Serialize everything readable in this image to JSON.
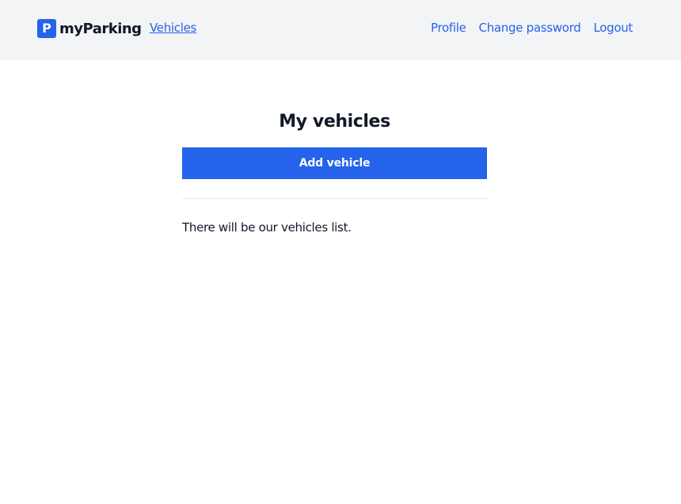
{
  "header": {
    "brand": {
      "icon_letter": "P",
      "name": "myParking",
      "icon_color": "#2563eb"
    },
    "nav_left": [
      {
        "label": "Vehicles"
      }
    ],
    "nav_right": [
      {
        "label": "Profile"
      },
      {
        "label": "Change password"
      },
      {
        "label": "Logout"
      }
    ]
  },
  "main": {
    "title": "My vehicles",
    "add_button_label": "Add vehicle",
    "list_placeholder": "There will be our vehicles list."
  },
  "colors": {
    "accent": "#2563eb",
    "header_bg": "#f3f4f6",
    "text": "#111827"
  }
}
